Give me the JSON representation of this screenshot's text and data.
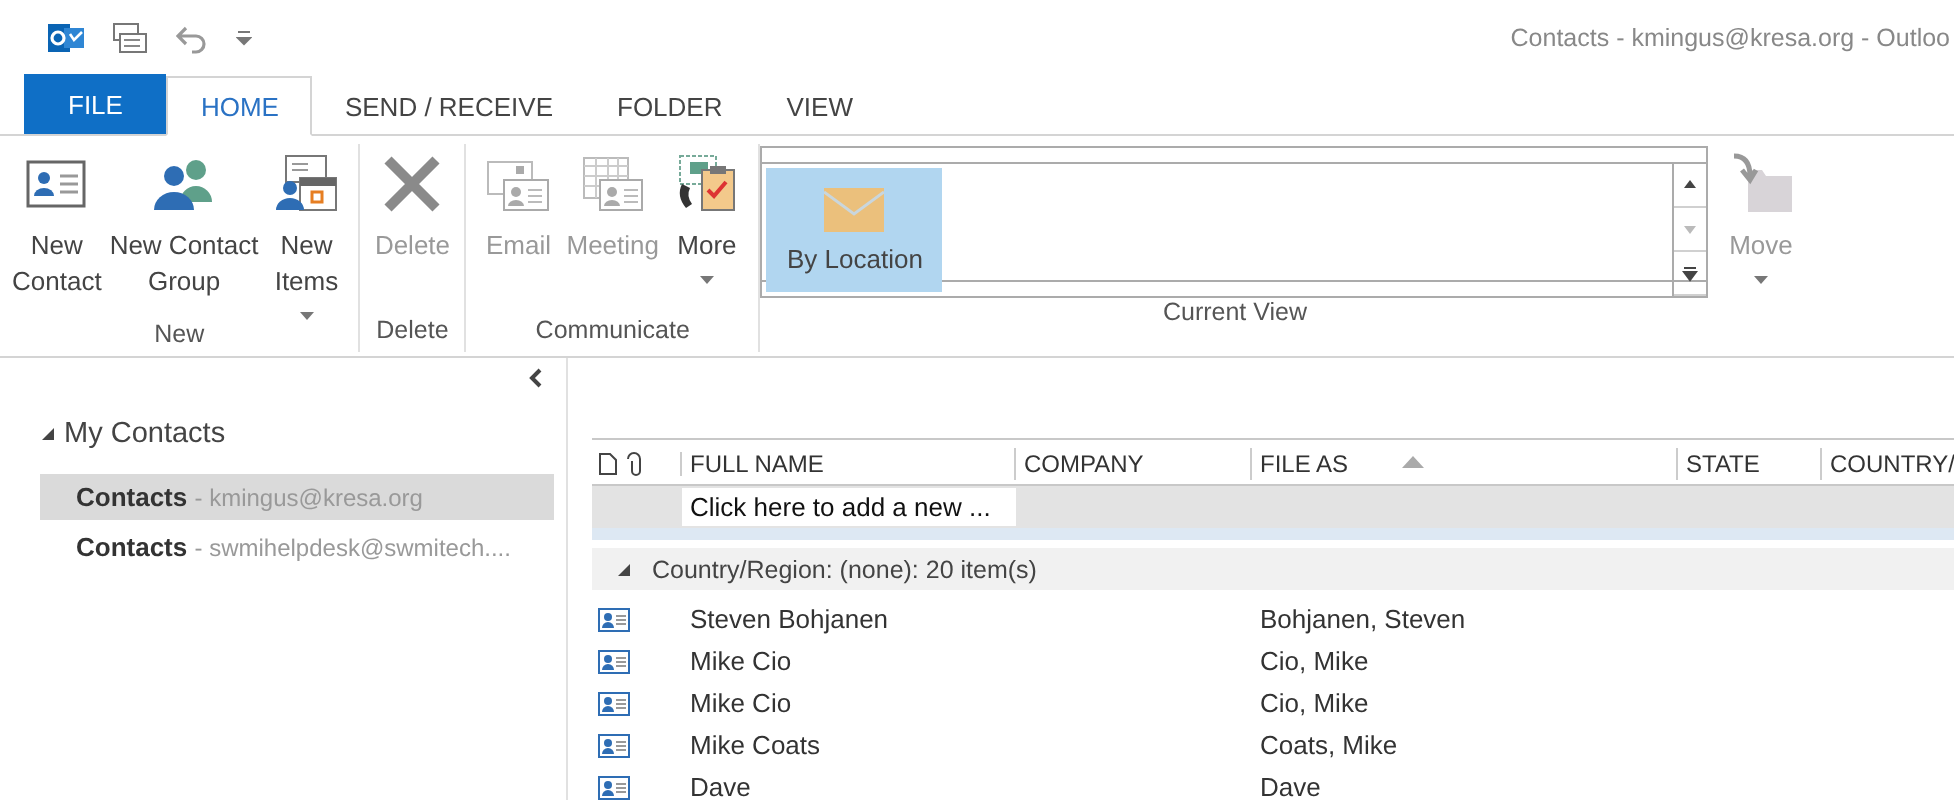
{
  "window": {
    "title": "Contacts - kmingus@kresa.org - Outloo"
  },
  "tabs": [
    {
      "label": "FILE",
      "kind": "file",
      "selected": false
    },
    {
      "label": "HOME",
      "kind": "tab",
      "selected": true
    },
    {
      "label": "SEND / RECEIVE",
      "kind": "tab",
      "selected": false
    },
    {
      "label": "FOLDER",
      "kind": "tab",
      "selected": false
    },
    {
      "label": "VIEW",
      "kind": "tab",
      "selected": false
    }
  ],
  "ribbon": {
    "groups": [
      {
        "label": "New",
        "kind": "buttons",
        "buttons": [
          {
            "lines": [
              "New",
              "Contact"
            ],
            "disabled": false,
            "dropdown": false
          },
          {
            "lines": [
              "New Contact",
              "Group"
            ],
            "disabled": false,
            "dropdown": false
          },
          {
            "lines": [
              "New",
              "Items"
            ],
            "disabled": false,
            "dropdown": true
          }
        ]
      },
      {
        "label": "Delete",
        "kind": "buttons",
        "buttons": [
          {
            "lines": [
              "Delete"
            ],
            "disabled": true,
            "dropdown": false
          }
        ]
      },
      {
        "label": "Communicate",
        "kind": "buttons",
        "buttons": [
          {
            "lines": [
              "Email"
            ],
            "disabled": true,
            "dropdown": false
          },
          {
            "lines": [
              "Meeting"
            ],
            "disabled": true,
            "dropdown": false
          },
          {
            "lines": [
              "More"
            ],
            "disabled": false,
            "dropdown": true
          }
        ]
      },
      {
        "label": "Current View",
        "kind": "gallery",
        "items": [
          {
            "label": "By Location",
            "selected": true
          }
        ]
      },
      {
        "kind": "buttons",
        "buttons": [
          {
            "lines": [
              "Move"
            ],
            "disabled": true,
            "dropdown": true
          }
        ]
      }
    ]
  },
  "navigation": {
    "folders": [
      {
        "label": "My Contacts",
        "expanded": true,
        "children": [
          {
            "name": "Contacts",
            "account": "- kmingus@kresa.org",
            "selected": true
          },
          {
            "name": "Contacts",
            "account": "- swmihelpdesk@swmitech....",
            "selected": false
          }
        ]
      }
    ]
  },
  "table": {
    "columns": [
      {
        "label": "FULL NAME"
      },
      {
        "label": "COMPANY"
      },
      {
        "label": "FILE AS",
        "sorted": true
      },
      {
        "label": "STATE"
      },
      {
        "label": "COUNTRY/"
      }
    ],
    "new_row": {
      "placeholder": "Click here to add a new ..."
    },
    "groups": [
      {
        "label": "Country/Region: (none): 20 item(s)",
        "expanded": true,
        "rows": [
          {
            "full_name": "Steven Bohjanen",
            "file_as": "Bohjanen, Steven"
          },
          {
            "full_name": "Mike Cio",
            "file_as": "Cio, Mike"
          },
          {
            "full_name": "Mike Cio",
            "file_as": "Cio, Mike"
          },
          {
            "full_name": "Mike Coats",
            "file_as": "Coats, Mike"
          },
          {
            "full_name": "Dave",
            "file_as": "Dave"
          }
        ]
      }
    ]
  }
}
